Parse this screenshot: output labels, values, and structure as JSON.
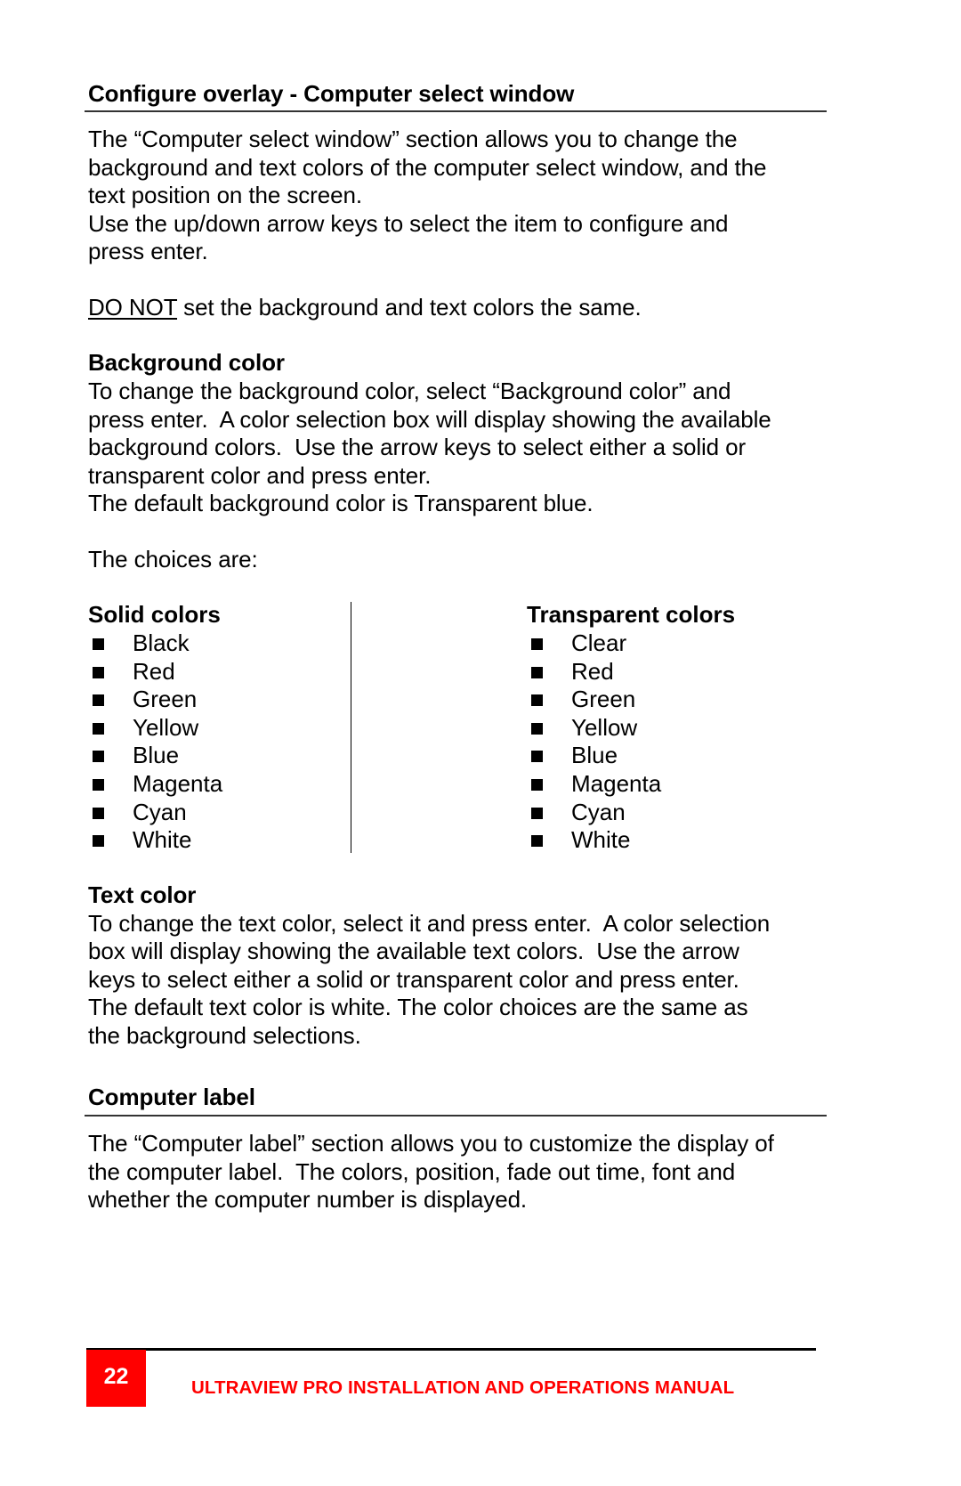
{
  "section1": {
    "title": "Configure overlay - Computer select window",
    "intro_lines": [
      "The “Computer select window” section allows you to change the",
      "background and text colors of the computer select window, and the",
      "text position on the screen.",
      "Use the up/down arrow keys to select the item to configure and",
      "press enter."
    ],
    "warning_emphasis": "DO NOT",
    "warning_rest": " set the background and text colors the same."
  },
  "background_color": {
    "heading": "Background color",
    "lines": [
      "To change the background color, select “Background color” and",
      "press enter.  A color selection box will display showing the available",
      "background colors.  Use the arrow keys to select either a solid or",
      "transparent color and press enter.",
      "The default background color is Transparent blue."
    ],
    "choices_intro": "The choices are:"
  },
  "color_lists": {
    "solid": {
      "heading": "Solid colors",
      "items": [
        "Black",
        "Red",
        "Green",
        "Yellow",
        "Blue",
        "Magenta",
        "Cyan",
        "White"
      ]
    },
    "transparent": {
      "heading": "Transparent colors",
      "items": [
        "Clear",
        "Red",
        "Green",
        "Yellow",
        "Blue",
        "Magenta",
        "Cyan",
        "White"
      ]
    },
    "bullet_icon": "square-bullet-icon"
  },
  "text_color": {
    "heading": "Text color",
    "lines": [
      "To change the text color, select it and press enter.  A color selection",
      "box will display showing the available text colors.  Use the arrow",
      "keys to select either a solid or transparent color and press enter.",
      "The default text color is white. The color choices are the same as",
      "the background selections."
    ]
  },
  "computer_label": {
    "heading": "Computer label",
    "lines": [
      "The “Computer label” section allows you to customize the display of",
      "the computer label.  The colors, position, fade out time, font and",
      "whether the computer number is displayed."
    ]
  },
  "footer": {
    "page_number": "22",
    "manual_title": "ULTRAVIEW PRO INSTALLATION AND OPERATIONS MANUAL",
    "accent_color": "#ff0000"
  }
}
